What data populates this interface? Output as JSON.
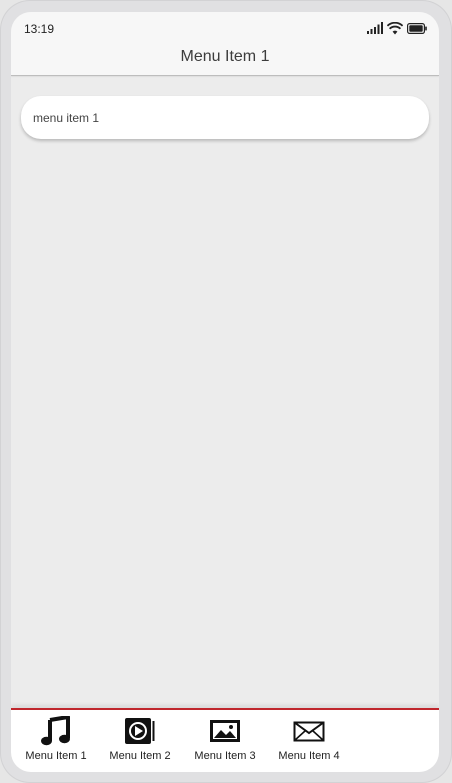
{
  "status_bar": {
    "time": "13:19",
    "icons": [
      "signal-icon",
      "wifi-icon",
      "battery-icon"
    ]
  },
  "app_bar": {
    "title": "Menu Item 1"
  },
  "content": {
    "items": [
      {
        "label": "menu item 1"
      }
    ]
  },
  "bottom_nav": {
    "accent_color": "#c0272d",
    "items": [
      {
        "label": "Menu Item 1",
        "icon": "music-note-icon"
      },
      {
        "label": "Menu Item 2",
        "icon": "video-icon"
      },
      {
        "label": "Menu Item 3",
        "icon": "image-icon"
      },
      {
        "label": "Menu Item 4",
        "icon": "envelope-icon"
      }
    ]
  }
}
